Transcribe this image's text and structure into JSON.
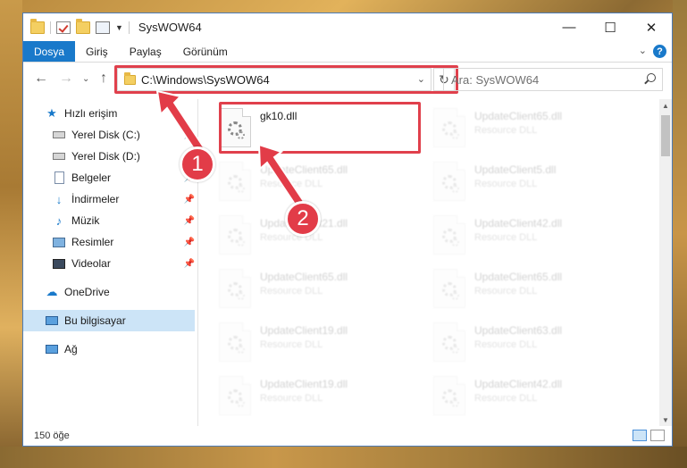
{
  "window": {
    "title": "SysWOW64"
  },
  "window_buttons": {
    "minimize": "—",
    "maximize": "☐",
    "close": "✕"
  },
  "ribbon": {
    "tabs": [
      "Dosya",
      "Giriş",
      "Paylaş",
      "Görünüm"
    ],
    "active_tab": "Dosya",
    "help": "?",
    "expand": "⌄"
  },
  "nav": {
    "back": "←",
    "forward": "→",
    "recent": "⌄",
    "up": "↑"
  },
  "address": {
    "path": "C:\\Windows\\SysWOW64",
    "dropdown": "⌄",
    "refresh": "↻"
  },
  "search": {
    "placeholder": "Ara: SysWOW64"
  },
  "sidebar": {
    "items": [
      {
        "label": "Hızlı erişim",
        "icon": "star-icon",
        "pinned": false
      },
      {
        "label": "Yerel Disk (C:)",
        "icon": "drive-icon",
        "pinned": true
      },
      {
        "label": "Yerel Disk (D:)",
        "icon": "drive-icon",
        "pinned": true
      },
      {
        "label": "Belgeler",
        "icon": "documents-icon",
        "pinned": true
      },
      {
        "label": "İndirmeler",
        "icon": "download-icon",
        "pinned": true
      },
      {
        "label": "Müzik",
        "icon": "music-icon",
        "pinned": true
      },
      {
        "label": "Resimler",
        "icon": "pictures-icon",
        "pinned": true
      },
      {
        "label": "Videolar",
        "icon": "videos-icon",
        "pinned": true
      },
      {
        "label": "OneDrive",
        "icon": "cloud-icon",
        "pinned": false
      },
      {
        "label": "Bu bilgisayar",
        "icon": "computer-icon",
        "pinned": false,
        "selected": true
      },
      {
        "label": "Ağ",
        "icon": "network-icon",
        "pinned": false
      }
    ]
  },
  "files": [
    {
      "name": "gk10.dll",
      "type": "",
      "faded": false
    },
    {
      "name": "UpdateClient65.dll",
      "type": "Resource DLL",
      "faded": true
    },
    {
      "name": "UpdateClient65.dll",
      "type": "Resource DLL",
      "faded": true
    },
    {
      "name": "UpdateClient5.dll",
      "type": "Resource DLL",
      "faded": true
    },
    {
      "name": "UpdateClient21.dll",
      "type": "Resource DLL",
      "faded": true
    },
    {
      "name": "UpdateClient42.dll",
      "type": "Resource DLL",
      "faded": true
    },
    {
      "name": "UpdateClient65.dll",
      "type": "Resource DLL",
      "faded": true
    },
    {
      "name": "UpdateClient65.dll",
      "type": "Resource DLL",
      "faded": true
    },
    {
      "name": "UpdateClient19.dll",
      "type": "Resource DLL",
      "faded": true
    },
    {
      "name": "UpdateClient63.dll",
      "type": "Resource DLL",
      "faded": true
    },
    {
      "name": "UpdateClient19.dll",
      "type": "Resource DLL",
      "faded": true
    },
    {
      "name": "UpdateClient42.dll",
      "type": "Resource DLL",
      "faded": true
    }
  ],
  "status": {
    "count": "150 öğe"
  },
  "annotations": {
    "step1": "1",
    "step2": "2"
  },
  "colors": {
    "accent": "#1979ca",
    "highlight": "#e0404c",
    "selected_bg": "#cce4f7"
  }
}
